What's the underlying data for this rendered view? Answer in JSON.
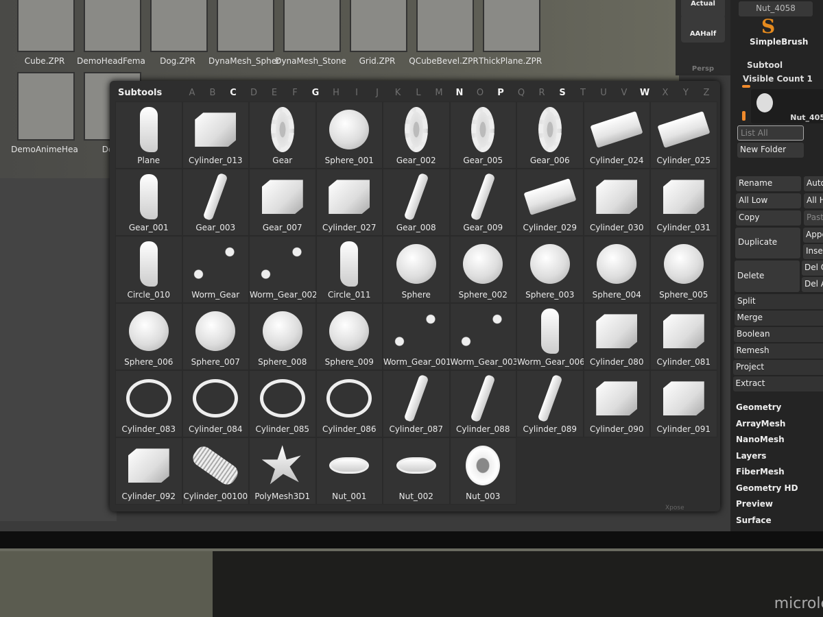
{
  "browser": {
    "row1": [
      "Cube.ZPR",
      "DemoHeadFema",
      "Dog.ZPR",
      "DynaMesh_Spher",
      "DynaMesh_Stone",
      "Grid.ZPR",
      "QCubeBevel.ZPR",
      "ThickPlane.ZPR"
    ],
    "row2": [
      "DemoAnimeHea",
      "De"
    ]
  },
  "toolbar": {
    "actual": "Actual",
    "aahalf": "AAHalf",
    "persp": "Persp"
  },
  "popup": {
    "title": "Subtools",
    "letters": [
      "A",
      "B",
      "C",
      "D",
      "E",
      "F",
      "G",
      "H",
      "I",
      "J",
      "K",
      "L",
      "M",
      "N",
      "O",
      "P",
      "Q",
      "R",
      "S",
      "T",
      "U",
      "V",
      "W",
      "X",
      "Y",
      "Z"
    ],
    "active_letters": [
      "C",
      "G",
      "N",
      "P",
      "S",
      "W"
    ],
    "items": [
      {
        "name": "Plane",
        "icon": "misc"
      },
      {
        "name": "Cylinder_013",
        "icon": "block"
      },
      {
        "name": "Gear",
        "icon": "gear"
      },
      {
        "name": "Sphere_001",
        "icon": "sphere"
      },
      {
        "name": "Gear_002",
        "icon": "gear"
      },
      {
        "name": "Gear_005",
        "icon": "gear"
      },
      {
        "name": "Gear_006",
        "icon": "gear"
      },
      {
        "name": "Cylinder_024",
        "icon": "cylinder"
      },
      {
        "name": "Cylinder_025",
        "icon": "cylinder"
      },
      {
        "name": "Gear_001",
        "icon": "misc"
      },
      {
        "name": "Gear_003",
        "icon": "thin"
      },
      {
        "name": "Gear_007",
        "icon": "block"
      },
      {
        "name": "Cylinder_027",
        "icon": "block"
      },
      {
        "name": "Gear_008",
        "icon": "thin"
      },
      {
        "name": "Gear_009",
        "icon": "thin"
      },
      {
        "name": "Cylinder_029",
        "icon": "cylinder"
      },
      {
        "name": "Cylinder_030",
        "icon": "block"
      },
      {
        "name": "Cylinder_031",
        "icon": "block"
      },
      {
        "name": "Circle_010",
        "icon": "misc"
      },
      {
        "name": "Worm_Gear",
        "icon": "worm"
      },
      {
        "name": "Worm_Gear_002",
        "icon": "worm"
      },
      {
        "name": "Circle_011",
        "icon": "misc"
      },
      {
        "name": "Sphere",
        "icon": "sphere"
      },
      {
        "name": "Sphere_002",
        "icon": "sphere"
      },
      {
        "name": "Sphere_003",
        "icon": "sphere"
      },
      {
        "name": "Sphere_004",
        "icon": "sphere"
      },
      {
        "name": "Sphere_005",
        "icon": "sphere"
      },
      {
        "name": "Sphere_006",
        "icon": "sphere"
      },
      {
        "name": "Sphere_007",
        "icon": "sphere"
      },
      {
        "name": "Sphere_008",
        "icon": "sphere"
      },
      {
        "name": "Sphere_009",
        "icon": "sphere"
      },
      {
        "name": "Worm_Gear_001",
        "icon": "worm"
      },
      {
        "name": "Worm_Gear_003",
        "icon": "worm"
      },
      {
        "name": "Worm_Gear_006",
        "icon": "misc"
      },
      {
        "name": "Cylinder_080",
        "icon": "block"
      },
      {
        "name": "Cylinder_081",
        "icon": "block"
      },
      {
        "name": "Cylinder_083",
        "icon": "clamp"
      },
      {
        "name": "Cylinder_084",
        "icon": "clamp"
      },
      {
        "name": "Cylinder_085",
        "icon": "clamp"
      },
      {
        "name": "Cylinder_086",
        "icon": "clamp"
      },
      {
        "name": "Cylinder_087",
        "icon": "thin"
      },
      {
        "name": "Cylinder_088",
        "icon": "thin"
      },
      {
        "name": "Cylinder_089",
        "icon": "thin"
      },
      {
        "name": "Cylinder_090",
        "icon": "block"
      },
      {
        "name": "Cylinder_091",
        "icon": "block"
      },
      {
        "name": "Cylinder_092",
        "icon": "block"
      },
      {
        "name": "Cylinder_00100",
        "icon": "tread"
      },
      {
        "name": "PolyMesh3D1",
        "icon": "star"
      },
      {
        "name": "Nut_001",
        "icon": "nut"
      },
      {
        "name": "Nut_002",
        "icon": "nut"
      },
      {
        "name": "Nut_003",
        "icon": "bignut"
      }
    ]
  },
  "right": {
    "current_tool": "Nut_4058",
    "brush": "SimpleBrush",
    "subtool_title": "Subtool",
    "visible_count": "Visible Count 1",
    "selected_subtool": "Nut_405",
    "list_all": "List All",
    "new_folder": "New Folder",
    "buttons": [
      [
        "Rename",
        "Auto"
      ],
      [
        "All Low",
        "All H"
      ],
      [
        "Copy",
        "Paste"
      ]
    ],
    "duplicate": "Duplicate",
    "append": "Appe",
    "insert": "Inser",
    "delete": "Delete",
    "del_other": "Del O",
    "del_all": "Del A",
    "actions": [
      "Split",
      "Merge",
      "Boolean",
      "Remesh",
      "Project",
      "Extract"
    ],
    "menus": [
      "Geometry",
      "ArrayMesh",
      "NanoMesh",
      "Layers",
      "FiberMesh",
      "Geometry HD",
      "Preview",
      "Surface"
    ]
  },
  "xpose": "Xpose",
  "brand": "microle",
  "colors": {
    "accent": "#f08a2c",
    "panel": "#2e2e2e"
  }
}
